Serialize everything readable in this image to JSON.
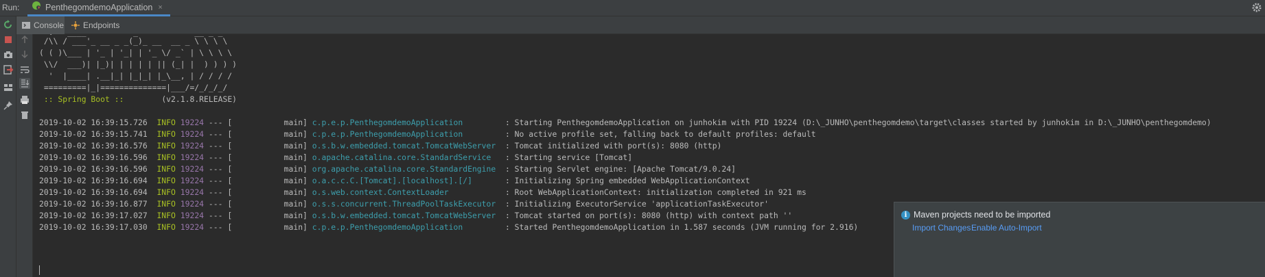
{
  "run_bar": {
    "label": "Run:",
    "tab_label": "PenthegomdemoApplication",
    "tab_close": "×"
  },
  "sub_tabs": [
    {
      "label": "Console",
      "active": true
    },
    {
      "label": "Endpoints",
      "active": false
    }
  ],
  "console": {
    "banner": [
      " /\\\\ / ___'_ __ _ _(_)_ __  __ _ \\ \\ \\ \\",
      "( ( )\\___ | '_ | '_| | '_ \\/ _` | \\ \\ \\ \\",
      " \\\\/  ___)| |_)| | | | | || (_| |  ) ) ) )",
      "  '  |____| .__|_| |_|_| |_\\__, | / / / /",
      " =========|_|==============|___/=/_/_/_/"
    ],
    "spring_boot_tag": " :: Spring Boot ::",
    "spring_boot_version": "        (v2.1.8.RELEASE)",
    "logs": [
      {
        "ts": "2019-10-02 16:39:15.726",
        "level": "INFO",
        "pid": "19224",
        "thread": "--- [           main]",
        "logger": "c.p.e.p.PenthegomdemoApplication        ",
        "message": ": Starting PenthegomdemoApplication on junhokim with PID 19224 (D:\\_JUNHO\\penthegomdemo\\target\\classes started by junhokim in D:\\_JUNHO\\penthegomdemo)"
      },
      {
        "ts": "2019-10-02 16:39:15.741",
        "level": "INFO",
        "pid": "19224",
        "thread": "--- [           main]",
        "logger": "c.p.e.p.PenthegomdemoApplication        ",
        "message": ": No active profile set, falling back to default profiles: default"
      },
      {
        "ts": "2019-10-02 16:39:16.576",
        "level": "INFO",
        "pid": "19224",
        "thread": "--- [           main]",
        "logger": "o.s.b.w.embedded.tomcat.TomcatWebServer ",
        "message": ": Tomcat initialized with port(s): 8080 (http)"
      },
      {
        "ts": "2019-10-02 16:39:16.596",
        "level": "INFO",
        "pid": "19224",
        "thread": "--- [           main]",
        "logger": "o.apache.catalina.core.StandardService  ",
        "message": ": Starting service [Tomcat]"
      },
      {
        "ts": "2019-10-02 16:39:16.596",
        "level": "INFO",
        "pid": "19224",
        "thread": "--- [           main]",
        "logger": "org.apache.catalina.core.StandardEngine ",
        "message": ": Starting Servlet engine: [Apache Tomcat/9.0.24]"
      },
      {
        "ts": "2019-10-02 16:39:16.694",
        "level": "INFO",
        "pid": "19224",
        "thread": "--- [           main]",
        "logger": "o.a.c.c.C.[Tomcat].[localhost].[/]      ",
        "message": ": Initializing Spring embedded WebApplicationContext"
      },
      {
        "ts": "2019-10-02 16:39:16.694",
        "level": "INFO",
        "pid": "19224",
        "thread": "--- [           main]",
        "logger": "o.s.web.context.ContextLoader           ",
        "message": ": Root WebApplicationContext: initialization completed in 921 ms"
      },
      {
        "ts": "2019-10-02 16:39:16.877",
        "level": "INFO",
        "pid": "19224",
        "thread": "--- [           main]",
        "logger": "o.s.s.concurrent.ThreadPoolTaskExecutor ",
        "message": ": Initializing ExecutorService 'applicationTaskExecutor'"
      },
      {
        "ts": "2019-10-02 16:39:17.027",
        "level": "INFO",
        "pid": "19224",
        "thread": "--- [           main]",
        "logger": "o.s.b.w.embedded.tomcat.TomcatWebServer ",
        "message": ": Tomcat started on port(s): 8080 (http) with context path ''"
      },
      {
        "ts": "2019-10-02 16:39:17.030",
        "level": "INFO",
        "pid": "19224",
        "thread": "--- [           main]",
        "logger": "c.p.e.p.PenthegomdemoApplication        ",
        "message": ": Started PenthegomdemoApplication in 1.587 seconds (JVM running for 2.916)"
      }
    ]
  },
  "notification": {
    "title": "Maven projects need to be imported",
    "link_import": "Import Changes",
    "link_auto": "Enable Auto-Import"
  },
  "colors": {
    "accent": "#4a88c7",
    "log_level": "#a8c023",
    "pid": "#9876aa",
    "logger": "#3d9fad",
    "link": "#589df6"
  }
}
